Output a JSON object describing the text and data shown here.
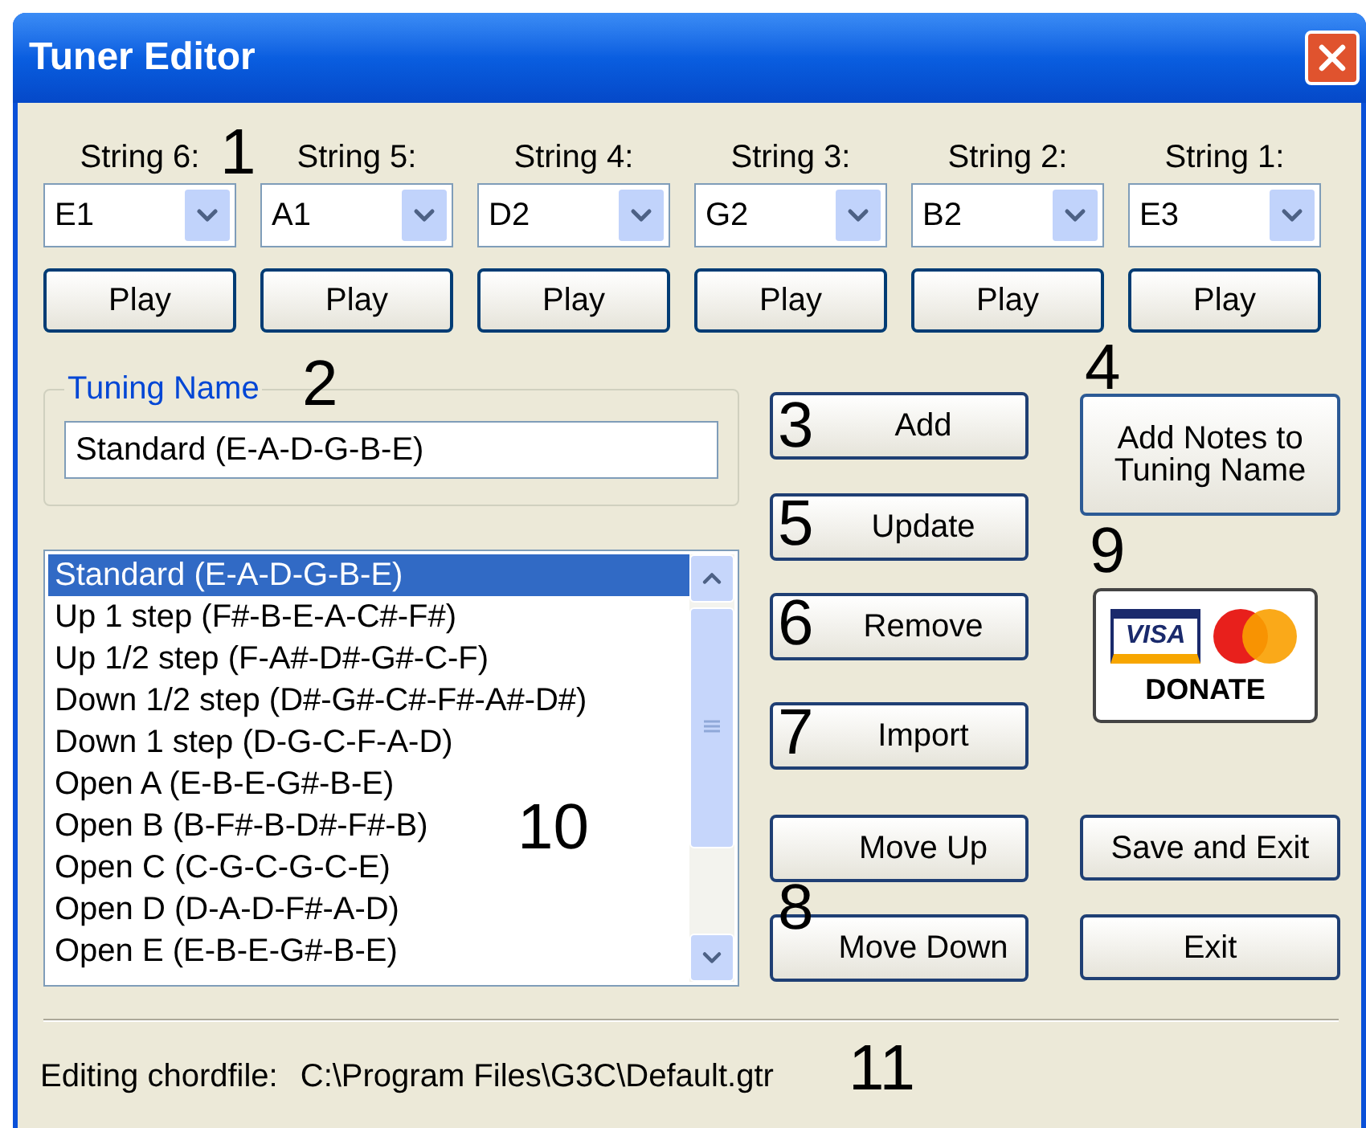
{
  "window": {
    "title": "Tuner Editor"
  },
  "strings": [
    {
      "label": "String 6:",
      "note": "E1",
      "button": "Play"
    },
    {
      "label": "String 5:",
      "note": "A1",
      "button": "Play"
    },
    {
      "label": "String 4:",
      "note": "D2",
      "button": "Play"
    },
    {
      "label": "String 3:",
      "note": "G2",
      "button": "Play"
    },
    {
      "label": "String 2:",
      "note": "B2",
      "button": "Play"
    },
    {
      "label": "String 1:",
      "note": "E3",
      "button": "Play"
    }
  ],
  "tuning_name": {
    "label": "Tuning Name",
    "value": "Standard (E-A-D-G-B-E)"
  },
  "tunings": [
    {
      "name": "Standard (E-A-D-G-B-E)",
      "selected": true
    },
    {
      "name": "Up 1 step (F#-B-E-A-C#-F#)",
      "selected": false
    },
    {
      "name": "Up 1/2 step (F-A#-D#-G#-C-F)",
      "selected": false
    },
    {
      "name": "Down 1/2 step (D#-G#-C#-F#-A#-D#)",
      "selected": false
    },
    {
      "name": "Down 1 step (D-G-C-F-A-D)",
      "selected": false
    },
    {
      "name": "Open A (E-B-E-G#-B-E)",
      "selected": false
    },
    {
      "name": "Open B (B-F#-B-D#-F#-B)",
      "selected": false
    },
    {
      "name": "Open C (C-G-C-G-C-E)",
      "selected": false
    },
    {
      "name": "Open D (D-A-D-F#-A-D)",
      "selected": false
    },
    {
      "name": "Open E (E-B-E-G#-B-E)",
      "selected": false
    }
  ],
  "list_buttons": [
    "Add",
    "Update",
    "Remove",
    "Import",
    "Move Up",
    "Move Down"
  ],
  "add_notes_button": "Add Notes to Tuning Name",
  "donate": {
    "card_text": "VISA",
    "label": "DONATE"
  },
  "save_button": "Save and Exit",
  "exit_button": "Exit",
  "status": {
    "label": "Editing chordfile:",
    "path": "C:\\Program Files\\G3C\\Default.gtr"
  },
  "callouts": [
    "1",
    "2",
    "3",
    "4",
    "5",
    "6",
    "7",
    "8",
    "9",
    "10",
    "11"
  ]
}
